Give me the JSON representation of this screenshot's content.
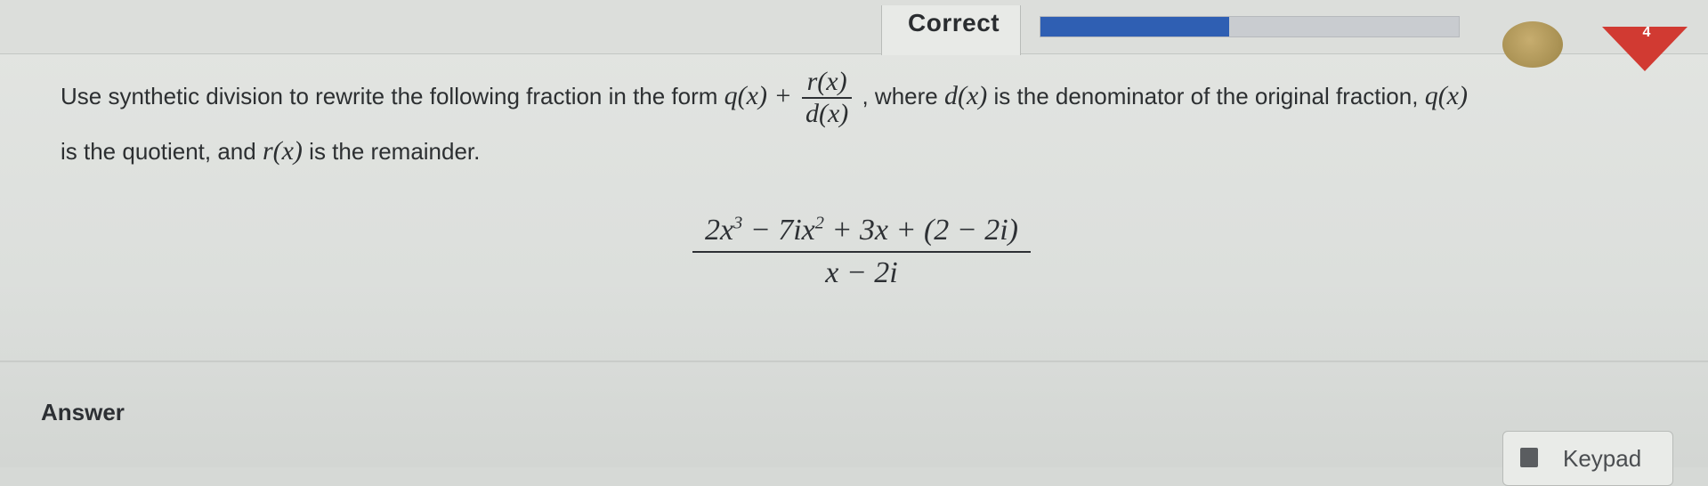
{
  "header": {
    "status": "Correct",
    "progress_percent": 45,
    "streak_count": "4",
    "colors": {
      "progress": "#2f5fb3",
      "streak": "#d13a32",
      "coin": "#b79c5b"
    }
  },
  "question": {
    "text_1": "Use synthetic division to rewrite the following fraction in the form",
    "q_x": "q(x) +",
    "frac_num": "r(x)",
    "frac_den": "d(x)",
    "text_2": ", where",
    "d_x": "d(x)",
    "text_3": "is the denominator of the original fraction,",
    "q_x2": "q(x)",
    "text_4": "is the quotient, and",
    "r_x": "r(x)",
    "text_5": "is the remainder.",
    "expression_numerator_a": "2x",
    "expression_exp_3": "3",
    "expression_numerator_b": " − 7ix",
    "expression_exp_2": "2",
    "expression_numerator_c": " + 3x + (2 − 2i)",
    "expression_denominator": "x − 2i"
  },
  "answer": {
    "label": "Answer",
    "keypad_label": "Keypad",
    "keypad_icon": "calculator-icon"
  }
}
